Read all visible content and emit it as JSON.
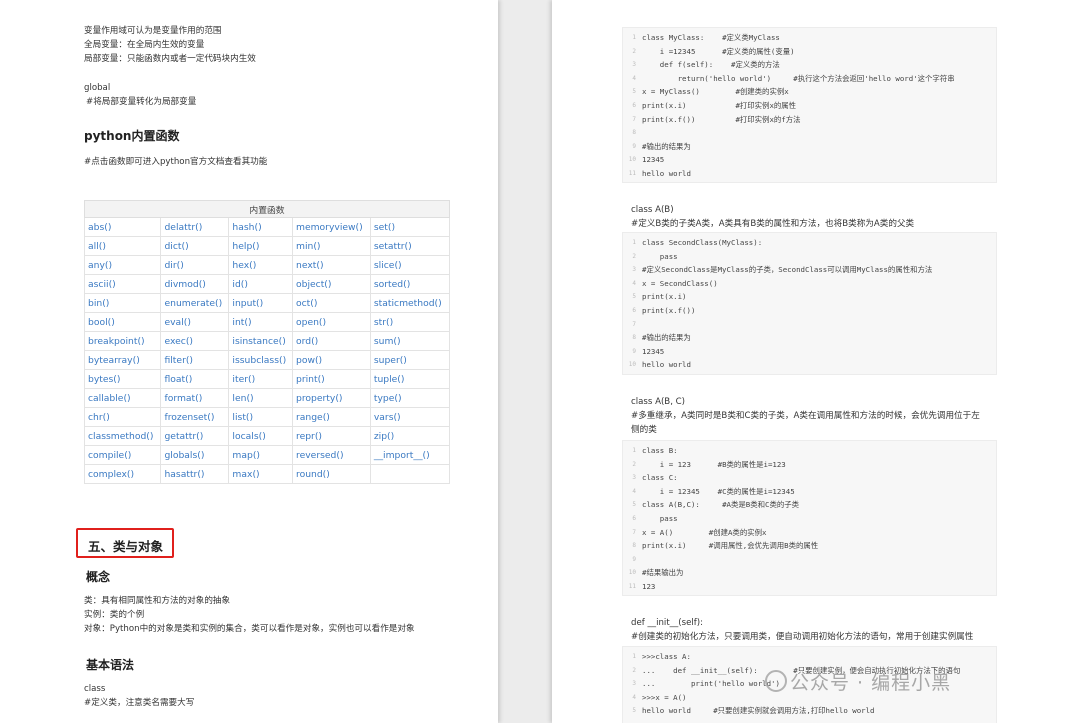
{
  "left": {
    "scope_lines": [
      "变量作用域可认为是变量作用的范围",
      "全局变量：在全局内生效的变量",
      "局部变量：只能函数内或者一定代码块内生效"
    ],
    "global_kw": "global",
    "global_comment": "#将局部变量转化为局部变量",
    "builtins_heading": "python内置函数",
    "builtins_note": "#点击函数即可进入python官方文档查看其功能",
    "table_header": "内置函数",
    "table_rows": [
      [
        "abs()",
        "delattr()",
        "hash()",
        "memoryview()",
        "set()"
      ],
      [
        "all()",
        "dict()",
        "help()",
        "min()",
        "setattr()"
      ],
      [
        "any()",
        "dir()",
        "hex()",
        "next()",
        "slice()"
      ],
      [
        "ascii()",
        "divmod()",
        "id()",
        "object()",
        "sorted()"
      ],
      [
        "bin()",
        "enumerate()",
        "input()",
        "oct()",
        "staticmethod()"
      ],
      [
        "bool()",
        "eval()",
        "int()",
        "open()",
        "str()"
      ],
      [
        "breakpoint()",
        "exec()",
        "isinstance()",
        "ord()",
        "sum()"
      ],
      [
        "bytearray()",
        "filter()",
        "issubclass()",
        "pow()",
        "super()"
      ],
      [
        "bytes()",
        "float()",
        "iter()",
        "print()",
        "tuple()"
      ],
      [
        "callable()",
        "format()",
        "len()",
        "property()",
        "type()"
      ],
      [
        "chr()",
        "frozenset()",
        "list()",
        "range()",
        "vars()"
      ],
      [
        "classmethod()",
        "getattr()",
        "locals()",
        "repr()",
        "zip()"
      ],
      [
        "compile()",
        "globals()",
        "map()",
        "reversed()",
        "__import__()"
      ],
      [
        "complex()",
        "hasattr()",
        "max()",
        "round()",
        ""
      ]
    ],
    "section_title": "五、类与对象",
    "concept_heading": "概念",
    "concept_lines": [
      "类：具有相同属性和方法的对象的抽象",
      "实例：类的个例",
      "对象：Python中的对象是类和实例的集合，类可以看作是对象，实例也可以看作是对象"
    ],
    "syntax_heading": "基本语法",
    "class_kw": "class",
    "class_note": "#定义类，注意类名需要大写"
  },
  "right": {
    "code1": [
      "class MyClass:    #定义类MyClass",
      "    i =12345      #定义类的属性(变量)",
      "    def f(self):    #定义类的方法",
      "        return('hello world')     #执行这个方法会返回'hello word'这个字符串",
      "x = MyClass()        #创建类的实例x",
      "print(x.i)           #打印实例x的属性",
      "print(x.f())         #打印实例x的f方法",
      "",
      "#输出的结果为",
      "12345",
      "hello world"
    ],
    "classA_title": "class A(B)",
    "classA_note": "#定义B类的子类A类，A类具有B类的属性和方法，也将B类称为A类的父类",
    "code2": [
      "class SecondClass(MyClass):",
      "    pass",
      "#定义SecondClass是MyClass的子类，SecondClass可以调用MyClass的属性和方法",
      "x = SecondClass()",
      "print(x.i)",
      "print(x.f())",
      "",
      "#输出的结果为",
      "12345",
      "hello world"
    ],
    "classABC_title": "class A(B, C)",
    "classABC_note1": "#多重继承，A类同时是B类和C类的子类，A类在调用属性和方法的时候，会优先调用位于左",
    "classABC_note2": "侧的类",
    "code3": [
      "class B:",
      "    i = 123      #B类的属性是i=123",
      "class C:",
      "    i = 12345    #C类的属性是i=12345",
      "class A(B,C):     #A类是B类和C类的子类",
      "    pass",
      "x = A()        #创建A类的实例x",
      "print(x.i)     #调用属性,会优先调用B类的属性",
      "",
      "#结果输出为",
      "123"
    ],
    "init_title": "def __init__(self):",
    "init_note": "#创建类的初始化方法，只要调用类，便自动调用初始化方法的语句，常用于创建实例属性",
    "code4": [
      ">>>class A:",
      "...    def __init__(self):        #只要创建实例，便会自动执行初始化方法下的语句",
      "...        print('hello world')",
      ">>>x = A()",
      "hello world     #只要创建实例就会调用方法,打印hello world"
    ]
  },
  "watermark": "公众号 · 编程小黑"
}
